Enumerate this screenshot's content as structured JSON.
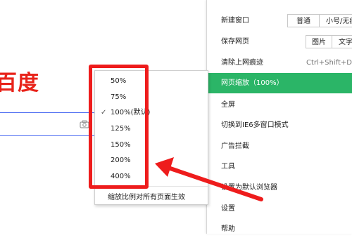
{
  "background": {
    "logo_text": "百度"
  },
  "menu": {
    "items": [
      {
        "label": "新建窗口",
        "segments": [
          "普通",
          "小号/无痕"
        ]
      },
      {
        "label": "保存网页",
        "segments": [
          "图片",
          "文字"
        ]
      },
      {
        "label": "清除上网痕迹",
        "shortcut": "Ctrl+Shift+Del"
      },
      {
        "label": "网页缩放（100%）",
        "active": true
      },
      {
        "label": "全屏"
      },
      {
        "label": "切换到IE6多窗口模式"
      },
      {
        "label": "广告拦截"
      },
      {
        "label": "工具"
      },
      {
        "label": "设置为默认浏览器"
      },
      {
        "label": "设置"
      },
      {
        "label": "帮助"
      }
    ]
  },
  "zoom_menu": {
    "options": [
      "50%",
      "75%",
      "100%(默认)",
      "125%",
      "150%",
      "200%",
      "400%"
    ],
    "selected": "100%(默认)",
    "apply_all_label": "缩放比例对所有页面生效"
  },
  "colors": {
    "accent": "#2bb567",
    "annotation": "#ee1c1c",
    "logo": "#e8231a"
  }
}
